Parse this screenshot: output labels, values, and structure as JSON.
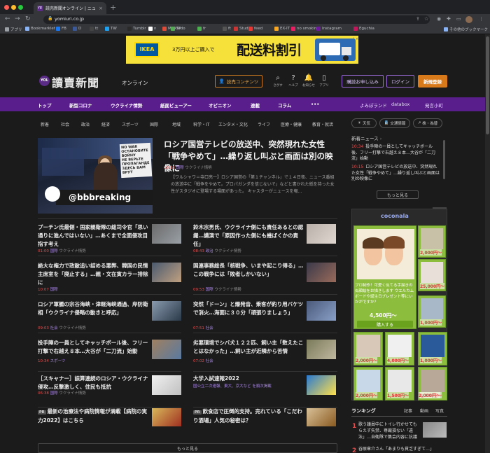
{
  "browser": {
    "tab_title": "読売新聞オンライン | ニュース&",
    "tab_favicon": "YE",
    "url": "yomiuri.co.jp",
    "bookmarks": [
      "アプリ",
      "Bookmarklet",
      "FB",
      "D",
      "tt",
      "TW",
      "Tumblr",
      "n",
      "MyASP",
      "Todo",
      "fr",
      "ft",
      "Studio",
      "feed",
      "EX-IT",
      "no smokin",
      "Instagram",
      "Eguchia"
    ],
    "bookmarks_other": "その他のブックマーク"
  },
  "ad": {
    "brand": "IKEA",
    "line1": "3万円以上ご購入で",
    "line2": "配送料割引",
    "info": "i ×"
  },
  "header": {
    "logo_mark": "YOL",
    "logo": "讀賣新聞",
    "logo_sub": "オンライン",
    "premium_btn": "読売コンテンツ",
    "icons": [
      {
        "glyph": "⌕",
        "label": "さがす",
        "name": "search-icon"
      },
      {
        "glyph": "?",
        "label": "ヘルプ",
        "name": "help-icon"
      },
      {
        "glyph": "🔔",
        "label": "お知らせ",
        "name": "bell-icon"
      },
      {
        "glyph": "▯",
        "label": "アプリ",
        "name": "app-icon"
      }
    ],
    "subscribe_btn": "購読お申し込み",
    "login_btn": "ログイン",
    "register_btn": "新規登録"
  },
  "nav": {
    "items": [
      "トップ",
      "新型コロナ",
      "ウクライナ情勢",
      "紙面ビューアー",
      "オピニオン",
      "連載",
      "コラム",
      "•••"
    ],
    "right": [
      "よみぽランド",
      "databox",
      "発言小町"
    ]
  },
  "subnav": [
    "新着",
    "社会",
    "政治",
    "経済",
    "スポーツ",
    "国際",
    "地域",
    "科学・IT",
    "エンタメ・文化",
    "ライフ",
    "医療・健康",
    "教育・就活"
  ],
  "pills": [
    {
      "label": "天気",
      "icon": "☀"
    },
    {
      "label": "交通情報",
      "icon": "🚆"
    },
    {
      "label": "株・為替",
      "icon": "↗"
    }
  ],
  "hero": {
    "sign_text": "NO WAR\nOСТАНОВИТЕ ВОЙНУ\nНЕ ВЕРЬТЕ ПРОПАГАНДЕ\nЗДЕСЬ ВАМ ВРУТ",
    "bb": "@bbbreaking",
    "title": "ロシア国営テレビの放送中、突然現れた女性「戦争やめて」…繰り返し叫ぶと画面は別の映像に",
    "time": "10:15",
    "cat": "国際",
    "tag": "ウクライナ情勢",
    "body": "【ワルシャワ＝寺口亮一】ロシア国営の「第１チャンネル」で１４日夜、ニュース番組の放送中に「戦争をやめて。プロパガンダを信じないで」などと書かれた紙を持った女性がスタジオに登場する場面があった。 キャスターがニュースを報..."
  },
  "stories_left": [
    {
      "title": "プーチン氏最側・国家親衛隊の総司令官「思い通りに進んではいない」…あくまで全面侵攻目指す考え",
      "time": "01:00",
      "cat": "国際",
      "tag": "ウクライナ情勢"
    },
    {
      "title": "絶大な権力で政敵追い詰める悪弊、韓国の民情主席室を「廃止する」…親・文在寅カラー排除に",
      "time": "10:07",
      "cat": "国際",
      "tag": ""
    },
    {
      "title": "ロシア軍艦の宗谷海峡・津軽海峡通過、岸防衛相「ウクライナ侵略の動きと呼応」",
      "time": "09:03",
      "cat": "社会",
      "tag": "ウクライナ情勢"
    },
    {
      "title": "投手陣の一員としてキャッチボール後、フリー打撃で右越え８本…大谷が「二刀流」始動",
      "time": "10:34",
      "cat": "スポーツ",
      "tag": ""
    },
    {
      "title": "［スキャナー］誤算連続のロシア・ウクライナ侵攻…反撃激しく、住民も抵抗",
      "time": "06:38",
      "cat": "国際",
      "tag": "ウクライナ情勢"
    },
    {
      "title": "最新の治療法や病院情報が満載【病院の実力2022】はこちら",
      "time": "",
      "cat": "",
      "tag": "",
      "pr": "PR"
    }
  ],
  "stories_right": [
    {
      "title": "鈴木宗男氏、ウクライナ側にも責任あるとの認識…講演で「原因作った側にも幾ばくかの責任」",
      "time": "08:43",
      "cat": "政治",
      "tag": "ウクライナ情勢"
    },
    {
      "title": "国連事務総長「核戦争、いまや起こり得る」…この戦争には「敗者しかいない」",
      "time": "09:53",
      "cat": "国際",
      "tag": "ウクライナ情勢"
    },
    {
      "title": "突然「ドーン」と爆発音、乗客が釣り用バケツで消火…海面に３０分「頑張りましょう」",
      "time": "07:51",
      "cat": "社会",
      "tag": ""
    },
    {
      "title": "劣悪環境でシバ犬１２２匹、飼い主「数えたことはなかった」…飼い主が近隣から苦情",
      "time": "07:02",
      "cat": "社会",
      "tag": ""
    },
    {
      "title": "大学入試速報2022",
      "time": "",
      "cat": "",
      "tag": "",
      "sub": "国公立二次速報、東大、京大など を順次掲載"
    },
    {
      "title": "飲食店で圧倒的支持。売れている「こだわり酒場」人気の秘密は？",
      "time": "",
      "cat": "",
      "tag": "",
      "pr": "PR"
    }
  ],
  "more_btn": "もっと見る",
  "sidebar": {
    "news_title": "新着ニュース",
    "news": [
      {
        "time": "10:34",
        "text": "投手陣の一員としてキャッチボール後、フリー打撃で右越え８本…大谷が「二刀流」始動"
      },
      {
        "time": "10:15",
        "text": "ロシア国営テレビの放送中、突然現れた女性「戦争やめて」…繰り返し叫ぶと画面は別の映像に"
      }
    ],
    "news_more": "もっと見る",
    "coconala_logo": "coconala",
    "main_card": {
      "title": "プロ制作！可愛く似てる手描きの似顔絵をお描きします ウエルカムボードや誕生日プレゼント等にいかがですか？",
      "price": "4,500円〜",
      "buy": "購入する"
    },
    "small_prices": [
      "2,000円〜",
      "25,000円〜",
      "1,000円〜",
      "2,000円〜",
      "4,000円〜",
      "1,000円〜",
      "2,000円〜",
      "1,500円〜",
      "3,000円〜",
      "2,000円〜"
    ],
    "ranking_title": "ランキング",
    "ranking_tabs": [
      "記事",
      "動画",
      "写真"
    ],
    "ranking": [
      {
        "rank": "1",
        "text": "歌う議員中にトイレ行かせてもらえず失禁、尊厳損ない「違法」…自衛隊で集会内容に抗議"
      },
      {
        "rank": "2",
        "text": "谷原章介さん「あまりも貧乏すぎて…」"
      }
    ]
  }
}
